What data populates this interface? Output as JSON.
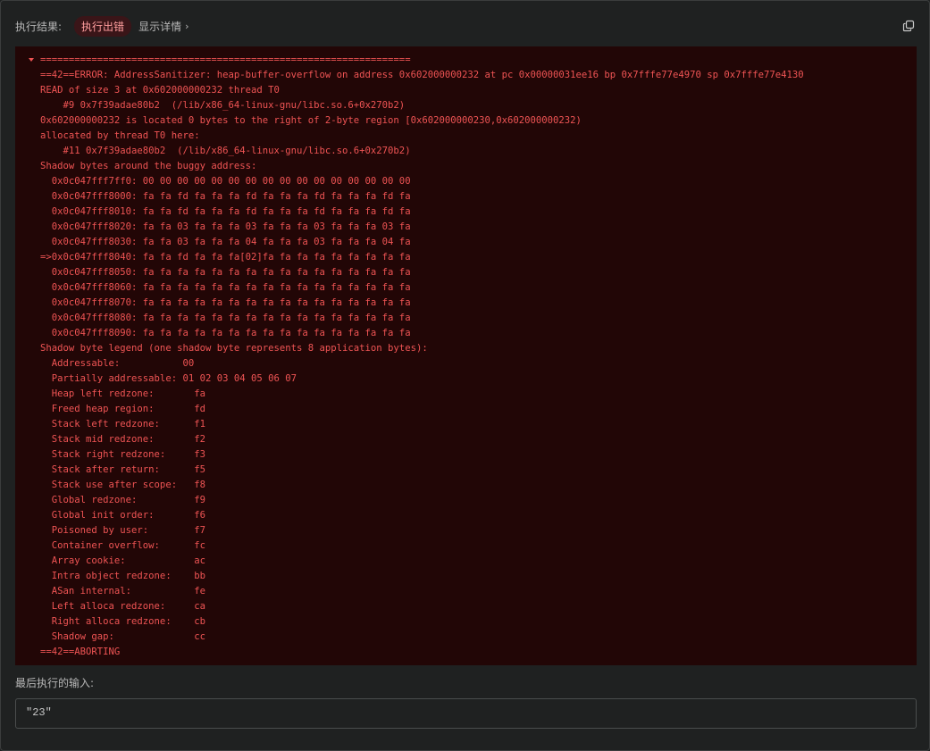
{
  "header": {
    "result_label": "执行结果:",
    "status_badge": "执行出错",
    "details_link": "显示详情",
    "accent_error": "#ef5454"
  },
  "log": {
    "lines": [
      "=================================================================",
      "==42==ERROR: AddressSanitizer: heap-buffer-overflow on address 0x602000000232 at pc 0x00000031ee16 bp 0x7fffe77e4970 sp 0x7fffe77e4130",
      "READ of size 3 at 0x602000000232 thread T0",
      "    #9 0x7f39adae80b2  (/lib/x86_64-linux-gnu/libc.so.6+0x270b2)",
      "0x602000000232 is located 0 bytes to the right of 2-byte region [0x602000000230,0x602000000232)",
      "allocated by thread T0 here:",
      "    #11 0x7f39adae80b2  (/lib/x86_64-linux-gnu/libc.so.6+0x270b2)",
      "Shadow bytes around the buggy address:",
      "  0x0c047fff7ff0: 00 00 00 00 00 00 00 00 00 00 00 00 00 00 00 00",
      "  0x0c047fff8000: fa fa fd fa fa fa fd fa fa fa fd fa fa fa fd fa",
      "  0x0c047fff8010: fa fa fd fa fa fa fd fa fa fa fd fa fa fa fd fa",
      "  0x0c047fff8020: fa fa 03 fa fa fa 03 fa fa fa 03 fa fa fa 03 fa",
      "  0x0c047fff8030: fa fa 03 fa fa fa 04 fa fa fa 03 fa fa fa 04 fa",
      "=>0x0c047fff8040: fa fa fd fa fa fa[02]fa fa fa fa fa fa fa fa fa",
      "  0x0c047fff8050: fa fa fa fa fa fa fa fa fa fa fa fa fa fa fa fa",
      "  0x0c047fff8060: fa fa fa fa fa fa fa fa fa fa fa fa fa fa fa fa",
      "  0x0c047fff8070: fa fa fa fa fa fa fa fa fa fa fa fa fa fa fa fa",
      "  0x0c047fff8080: fa fa fa fa fa fa fa fa fa fa fa fa fa fa fa fa",
      "  0x0c047fff8090: fa fa fa fa fa fa fa fa fa fa fa fa fa fa fa fa",
      "Shadow byte legend (one shadow byte represents 8 application bytes):",
      "  Addressable:           00",
      "  Partially addressable: 01 02 03 04 05 06 07",
      "  Heap left redzone:       fa",
      "  Freed heap region:       fd",
      "  Stack left redzone:      f1",
      "  Stack mid redzone:       f2",
      "  Stack right redzone:     f3",
      "  Stack after return:      f5",
      "  Stack use after scope:   f8",
      "  Global redzone:          f9",
      "  Global init order:       f6",
      "  Poisoned by user:        f7",
      "  Container overflow:      fc",
      "  Array cookie:            ac",
      "  Intra object redzone:    bb",
      "  ASan internal:           fe",
      "  Left alloca redzone:     ca",
      "  Right alloca redzone:    cb",
      "  Shadow gap:              cc",
      "==42==ABORTING"
    ]
  },
  "last_input": {
    "label": "最后执行的输入:",
    "value": "\"23\""
  },
  "icons": {
    "collapse": "caret-down-icon",
    "details": "chevron-right-icon",
    "copy": "copy-icon"
  }
}
